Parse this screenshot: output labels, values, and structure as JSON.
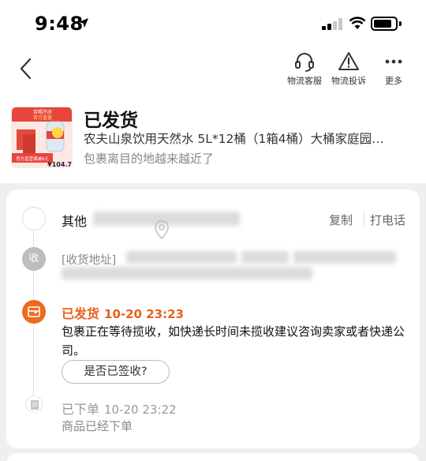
{
  "status_bar": {
    "time": "9:48"
  },
  "nav": {
    "actions": [
      {
        "label": "物流客服",
        "icon": "headset-icon"
      },
      {
        "label": "物流投诉",
        "icon": "warning-icon"
      },
      {
        "label": "更多",
        "icon": "more-icon"
      }
    ]
  },
  "thumbnail": {
    "line1": "百喝不厌",
    "line2": "官方直营",
    "promo": "官方直营满减6元",
    "price": "¥104.7"
  },
  "order": {
    "status": "已发货",
    "product_name": "农夫山泉饮用天然水 5L*12桶（1箱4桶）大桶家庭园…",
    "sub_message": "包裹离目的地越来越近了"
  },
  "timeline": {
    "contact": {
      "label": "其他",
      "copy_label": "复制",
      "call_label": "打电话"
    },
    "address": {
      "icon_text": "收",
      "prefix": "[收货地址]"
    },
    "shipped": {
      "title": "已发货",
      "time": "10-20 23:23",
      "description": "包裹正在等待揽收，如快递长时间未揽收建议咨询卖家或者快递公司。",
      "button": "是否已签收?"
    },
    "ordered": {
      "title": "已下单",
      "time": "10-20 23:22",
      "description": "商品已经下单"
    }
  },
  "colors": {
    "accent": "#ed6b1f",
    "accent_text": "#e8601c"
  }
}
